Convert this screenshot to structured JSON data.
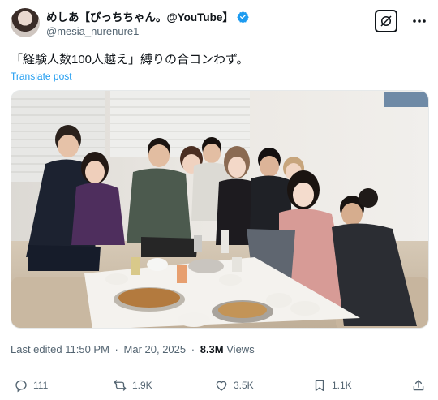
{
  "author": {
    "display_name": "めしあ【びっちちゃん。@YouTube】",
    "handle": "@mesia_nurenure1",
    "verified": true
  },
  "tweet": {
    "text": "「経験人数100人越え」縛りの合コンわず。",
    "translate_label": "Translate post"
  },
  "meta": {
    "edited_label": "Last edited",
    "time": "11:50 PM",
    "date": "Mar 20, 2025",
    "views_count": "8.3M",
    "views_label": "Views"
  },
  "actions": {
    "replies": "111",
    "reposts": "1.9K",
    "likes": "3.5K",
    "bookmarks": "1.1K"
  },
  "colors": {
    "link": "#1d9bf0",
    "verified": "#1d9bf0",
    "secondary_text": "#536471"
  }
}
